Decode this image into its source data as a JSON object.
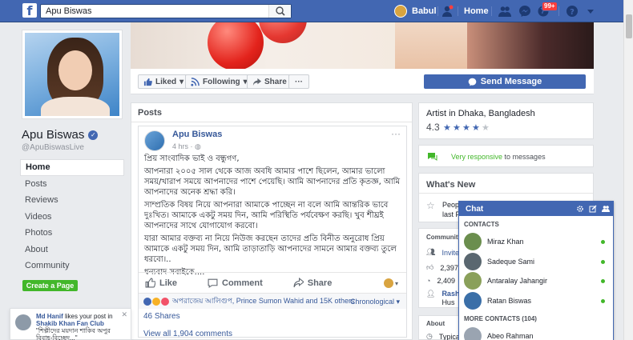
{
  "topbar": {
    "search_value": "Apu Biswas",
    "user_name": "Babul",
    "home_label": "Home",
    "notifications_badge": "99+"
  },
  "page": {
    "name": "Apu Biswas",
    "handle": "@ApuBiswasLive",
    "nav": [
      "Home",
      "Posts",
      "Reviews",
      "Videos",
      "Photos",
      "About",
      "Community"
    ],
    "create_page_label": "Create a Page"
  },
  "actions": {
    "liked_label": "Liked",
    "following_label": "Following",
    "share_label": "Share",
    "more_label": "···",
    "send_message_label": "Send Message"
  },
  "posts": {
    "header": "Posts",
    "post": {
      "author": "Apu Biswas",
      "time": "4 hrs ·",
      "paragraphs": [
        "প্রিয় সাংবাদিক ভাই ও বন্ধুগণ,",
        "আপনারা ২০০৫ সাল থেকে আজ অবধি আমার পাশে ছিলেন, আমার ভালো সময়/খারাপ সময়ে আপনাদের পাশে পেয়েছি। আমি আপনাদের প্রতি কৃতজ্ঞ, আমি আপনাদের অনেক শ্রদ্ধা করি।",
        "সাম্প্রতিক বিষয় নিয়ে আপনারা আমাকে পাচ্ছেন না বলে আমি আন্তরিক ভাবে দুঃখিত। আমাকে একটু সময় দিন, আমি পরিস্থিতি পর্যবেক্ষণ করছি। খুব শীঘ্রই আপনাদের সাথে যোগাযোগ করবো।",
        "যারা আমার বক্তব্য না নিয়ে নিউজ করছেন তাদের প্রতি বিনীত অনুরোধ প্রিয় আমাকে একটু সময় দিন, আমি তাড়াতাড়ি আপনাদের সামনে আমার বক্তব্য তুলে ধরবো।..",
        "ধন্যবাদ সবাইকে...."
      ],
      "like_label": "Like",
      "comment_label": "Comment",
      "share_label": "Share",
      "reactions_text": "অপরাজেয় আলিগুপ, Prince Sumon Wahid and 15K others",
      "sort_label": "Chronological ▾",
      "shares_text": "46 Shares",
      "view_comments_text": "View all 1,904 comments"
    }
  },
  "right": {
    "about_title": "Artist in Dhaka, Bangladesh",
    "rating": "4.3",
    "stars": 4,
    "responsive": "Very responsive",
    "responsive_suffix": " to messages",
    "whats_new": "What's New",
    "whats_new_line1": "People",
    "whats_new_line2": "last P",
    "community_title": "Community",
    "community_invite": "Invite",
    "community_count1": "2,397",
    "community_count2": "2,409",
    "community_rash": "Rash",
    "community_sub": "Hus",
    "about_label": "About",
    "about_typical": "Typica"
  },
  "chat": {
    "title": "Chat",
    "contacts_header": "CONTACTS",
    "contacts": [
      {
        "name": "Miraz Khan",
        "color": "#6b8e4e"
      },
      {
        "name": "Sadeque Sami",
        "color": "#5a6770"
      },
      {
        "name": "Antaralay Jahangir",
        "color": "#8aa05a"
      },
      {
        "name": "Ratan Biswas",
        "color": "#3b6fa8"
      }
    ],
    "more_header": "MORE CONTACTS (104)",
    "more_contacts": [
      {
        "name": "Abeo Rahman",
        "color": "#9aa4b1"
      }
    ]
  },
  "notification": {
    "author": "Md Hanif",
    "text_mid": " likes your post in ",
    "group": "Shakib Khan Fan Club",
    "text_tail": "\"শিল্পীদের ময়দান শাকিব অপুর বিবাহ-বিচ্ছেদ...\""
  }
}
